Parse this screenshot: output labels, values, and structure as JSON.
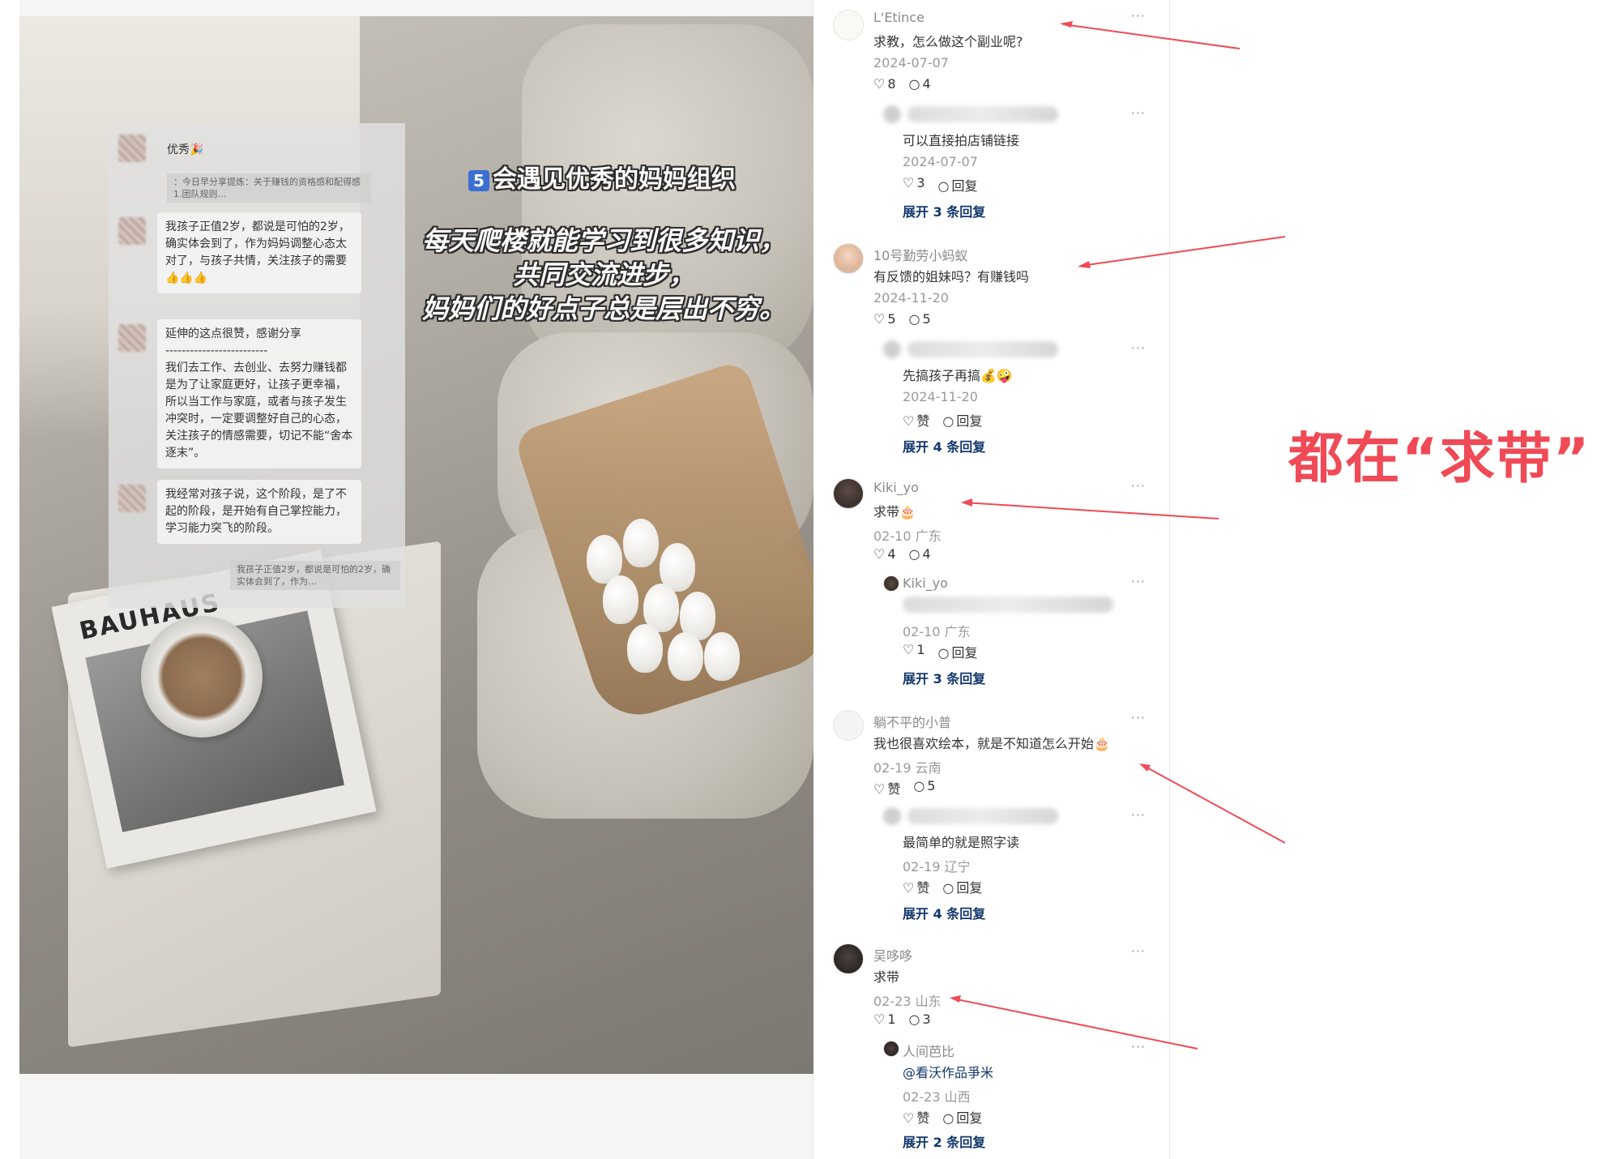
{
  "image_overlay": {
    "chat": [
      {
        "name": "优秀🎉",
        "quote": "：今日早分享提炼：关于赚钱的资格感和配得感 1.团队规则…"
      },
      {
        "text": "我孩子正值2岁，都说是可怕的2岁，确实体会到了，作为妈妈调整心态太对了，与孩子共情，关注孩子的需要👍👍👍"
      },
      {
        "text": "延伸的这点很赞，感谢分享\n-------------------------\n我们去工作、去创业、去努力赚钱都是为了让家庭更好，让孩子更幸福，所以当工作与家庭，或者与孩子发生冲突时，一定要调整好自己的心态，关注孩子的情感需要，切记不能“舍本逐末”。"
      },
      {
        "text": "我经常对孩子说，这个阶段，是了不起的阶段，是开始有自己掌控能力，学习能力突飞的阶段。"
      },
      {
        "quote": "我孩子正值2岁，都说是可怕的2岁，确实体会到了，作为…"
      }
    ],
    "book_title": "BAUHAUS",
    "caption_num": "5",
    "caption_title": "会遇见优秀的妈妈组织",
    "caption_body": "每天爬楼就能学习到很多知识，\n共同交流进步，\n妈妈们的好点子总是层出不穷。"
  },
  "comments": [
    {
      "username": "L'Etince",
      "content": "求教，怎么做这个副业呢?",
      "date": "2024-07-07",
      "likes": "8",
      "replies": "4",
      "reply": {
        "content": "可以直接拍店铺链接",
        "date": "2024-07-07",
        "likes": "3",
        "reply_label": "回复"
      },
      "expand": "展开 3 条回复"
    },
    {
      "username": "10号勤劳小蚂蚁",
      "content": "有反馈的姐妹吗？有赚钱吗",
      "date": "2024-11-20",
      "likes": "5",
      "replies": "5",
      "reply": {
        "content": "先搞孩子再搞💰🤪",
        "date": "2024-11-20",
        "likes": "赞",
        "reply_label": "回复"
      },
      "expand": "展开 4 条回复"
    },
    {
      "username": "Kiki_yo",
      "content": "求带🎂",
      "date": "02-10 广东",
      "likes": "4",
      "replies": "4",
      "reply": {
        "username": "Kiki_yo",
        "date": "02-10 广东",
        "likes": "1",
        "reply_label": "回复"
      },
      "expand": "展开 3 条回复"
    },
    {
      "username": "躺不平的小普",
      "content": "我也很喜欢绘本，就是不知道怎么开始🎂",
      "date": "02-19 云南",
      "likes": "赞",
      "replies": "5",
      "reply": {
        "content": "最简单的就是照字读",
        "date": "02-19 辽宁",
        "likes": "赞",
        "reply_label": "回复"
      },
      "expand": "展开 4 条回复"
    },
    {
      "username": "吴哆哆",
      "content": "求带",
      "date": "02-23 山东",
      "likes": "1",
      "replies": "3",
      "reply": {
        "username": "人间芭比",
        "content": "@看沃作品爭米",
        "date": "02-23 山西",
        "likes": "赞",
        "reply_label": "回复"
      },
      "expand": "展开 2 条回复"
    }
  ],
  "more_label": "···",
  "annotation": "都在“求带”",
  "colors": {
    "annotation": "#ef4a55",
    "expand": "#13386c",
    "muted": "#9a9a9a"
  },
  "icons": {
    "like": "heart-icon",
    "comment": "comment-bubble-icon",
    "more": "more-dots-icon"
  }
}
